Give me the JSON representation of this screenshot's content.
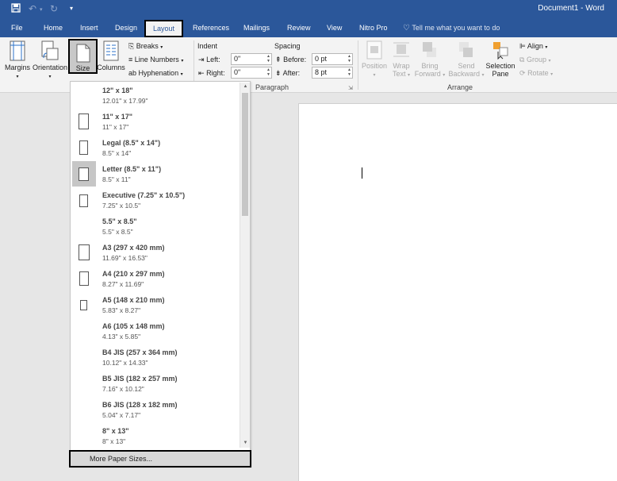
{
  "window": {
    "title": "Document1 - Word"
  },
  "qat": {
    "save_icon": "save-icon",
    "undo_icon": "undo-icon",
    "redo_icon": "redo-icon",
    "customize_icon": "customize-qat-icon"
  },
  "tabs": [
    "File",
    "Home",
    "Insert",
    "Design",
    "Layout",
    "References",
    "Mailings",
    "Review",
    "View",
    "Nitro Pro"
  ],
  "active_tab": "Layout",
  "tell_me": "Tell me what you want to do",
  "ribbon": {
    "margins": "Margins",
    "orientation": "Orientation",
    "size": "Size",
    "columns": "Columns",
    "breaks": "Breaks",
    "line_numbers": "Line Numbers",
    "hyphenation": "Hyphenation",
    "indent_label": "Indent",
    "left_label": "Left:",
    "left_value": "0\"",
    "right_label": "Right:",
    "right_value": "0\"",
    "spacing_label": "Spacing",
    "before_label": "Before:",
    "before_value": "0 pt",
    "after_label": "After:",
    "after_value": "8 pt",
    "paragraph_group": "Paragraph",
    "position": "Position",
    "wrap_text_1": "Wrap",
    "wrap_text_2": "Text",
    "bring_forward_1": "Bring",
    "bring_forward_2": "Forward",
    "send_backward_1": "Send",
    "send_backward_2": "Backward",
    "selection_pane_1": "Selection",
    "selection_pane_2": "Pane",
    "align": "Align",
    "group": "Group",
    "rotate": "Rotate",
    "arrange_group": "Arrange"
  },
  "size_menu": {
    "items": [
      {
        "name": "12\" x 18\"",
        "dims": "12.01\" x 17.99\""
      },
      {
        "name": "11\" x 17\"",
        "dims": "11\" x 17\""
      },
      {
        "name": "Legal (8.5\" x 14\")",
        "dims": "8.5\" x 14\""
      },
      {
        "name": "Letter (8.5\" x 11\")",
        "dims": "8.5\" x 11\""
      },
      {
        "name": "Executive (7.25\" x 10.5\")",
        "dims": "7.25\" x 10.5\""
      },
      {
        "name": "5.5\" x 8.5\"",
        "dims": "5.5\" x 8.5\""
      },
      {
        "name": "A3 (297 x 420 mm)",
        "dims": "11.69\" x 16.53\""
      },
      {
        "name": "A4 (210 x 297 mm)",
        "dims": "8.27\" x 11.69\""
      },
      {
        "name": "A5 (148 x 210 mm)",
        "dims": "5.83\" x 8.27\""
      },
      {
        "name": "A6 (105 x 148 mm)",
        "dims": "4.13\" x 5.85\""
      },
      {
        "name": "B4 JIS (257 x 364 mm)",
        "dims": "10.12\" x 14.33\""
      },
      {
        "name": "B5 JIS (182 x 257 mm)",
        "dims": "7.16\" x 10.12\""
      },
      {
        "name": "B6 JIS (128 x 182 mm)",
        "dims": "5.04\" x 7.17\""
      },
      {
        "name": "8\" x 13\"",
        "dims": "8\" x 13\""
      }
    ],
    "selected": "Letter (8.5\" x 11\")",
    "more": "More Paper Sizes..."
  }
}
